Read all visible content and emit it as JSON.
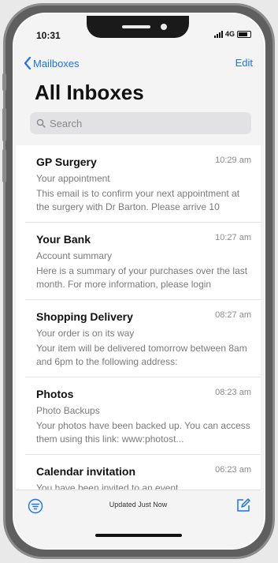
{
  "status": {
    "time": "10:31",
    "network": "4G"
  },
  "nav": {
    "back_label": "Mailboxes",
    "edit_label": "Edit"
  },
  "title": "All Inboxes",
  "search": {
    "placeholder": "Search"
  },
  "messages": [
    {
      "sender": "GP Surgery",
      "time": "10:29 am",
      "subject": "Your appointment",
      "preview": "This email is to confirm your next appointment at the surgery with Dr Barton. Please arrive 10"
    },
    {
      "sender": "Your Bank",
      "time": "10:27 am",
      "subject": "Account summary",
      "preview": "Here is a summary of your purchases over the last month. For more information, please login"
    },
    {
      "sender": "Shopping Delivery",
      "time": "08:27 am",
      "subject": "Your order is on its way",
      "preview": "Your item will be delivered tomorrow between 8am and 6pm to the following address:"
    },
    {
      "sender": "Photos",
      "time": "08:23 am",
      "subject": "Photo Backups",
      "preview": "Your photos have been backed up. You can access them using this link: www:photost..."
    },
    {
      "sender": "Calendar invitation",
      "time": "06:23 am",
      "subject": "You have been invited to an event",
      "preview": ""
    }
  ],
  "toolbar": {
    "status_text": "Updated Just Now"
  },
  "colors": {
    "accent": "#1a73e8",
    "frame": "#5f5f5f"
  }
}
